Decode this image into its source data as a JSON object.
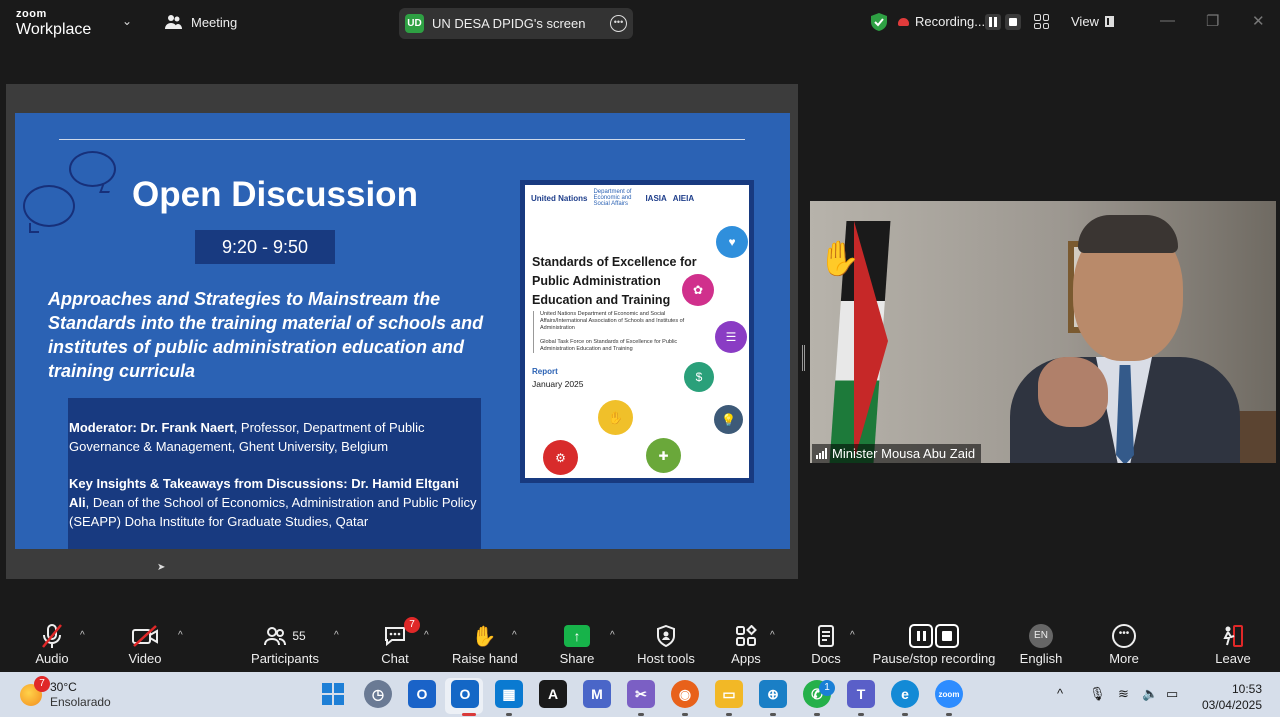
{
  "titlebar": {
    "brand_top": "zoom",
    "brand_bottom": "Workplace",
    "meeting_label": "Meeting",
    "share_initials": "UD",
    "share_title": "UN DESA DPIDG's screen",
    "recording_label": "Recording...",
    "view_label": "View"
  },
  "slide": {
    "title": "Open Discussion",
    "time": "9:20 - 9:50",
    "subtitle": "Approaches and Strategies to Mainstream the Standards into the training material of schools and institutes of public administration education and training curricula",
    "moderator_label": "Moderator: Dr. Frank Naert",
    "moderator_text": ", Professor, Department of Public Governance & Management, Ghent University, Belgium",
    "insights_label": "Key Insights & Takeaways from Discussions: Dr. Hamid Eltgani Ali",
    "insights_text": ", Dean of the School of Economics, Administration and Public Policy (SEAPP) Doha Institute for Graduate Studies, Qatar"
  },
  "report": {
    "logo_un": "United Nations",
    "logo_dept": "Department of Economic and Social Affairs",
    "logo_iasia": "IASIA",
    "logo_aieia": "AIEIA",
    "title": "Standards of Excellence for Public Administration Education and Training",
    "body1": "United Nations Department of Economic and Social Affairs/International Association of Schools and Institutes of Administration",
    "body2": "Global Task Force on Standards of Excellence for Public Administration Education and Training",
    "label": "Report",
    "date": "January 2025"
  },
  "video": {
    "participant_name": "Minister Mousa Abu Zaid"
  },
  "toolbar": {
    "audio": "Audio",
    "video": "Video",
    "participants": "Participants",
    "participants_count": "55",
    "chat": "Chat",
    "chat_badge": "7",
    "raise_hand": "Raise hand",
    "share": "Share",
    "host_tools": "Host tools",
    "apps": "Apps",
    "docs": "Docs",
    "pause_stop": "Pause/stop recording",
    "language_code": "EN",
    "language": "English",
    "more": "More",
    "leave": "Leave"
  },
  "taskbar": {
    "weather_badge": "7",
    "temperature": "30°C",
    "condition": "Ensolarado",
    "whatsapp_badge": "1",
    "time": "10:53",
    "date": "03/04/2025"
  },
  "colors": {
    "slide_blue": "#2b62b4",
    "slide_navy": "#183a80",
    "share_green": "#17b34a",
    "badge_red": "#e02828"
  }
}
